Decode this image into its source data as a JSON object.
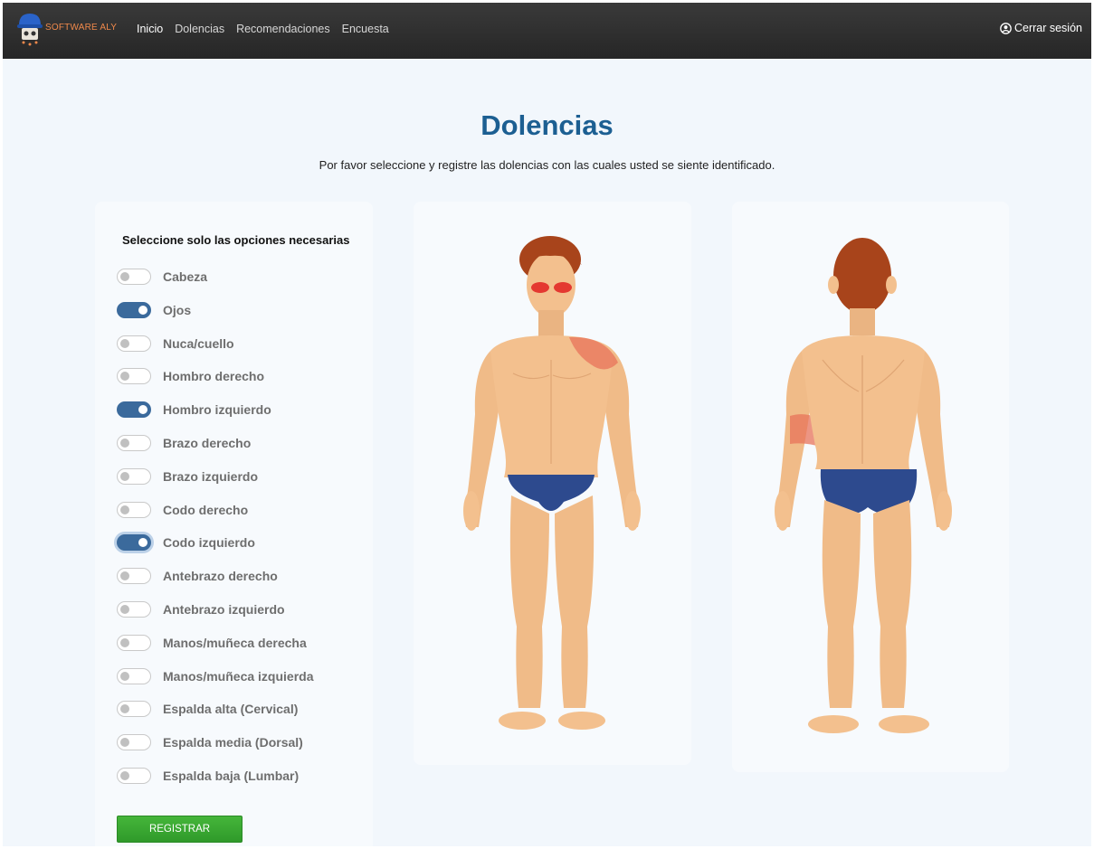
{
  "brand": {
    "name": "SOFTWARE ALY"
  },
  "nav": {
    "links": [
      "Inicio",
      "Dolencias",
      "Recomendaciones",
      "Encuesta"
    ],
    "active": "Inicio",
    "logout_label": "Cerrar sesión"
  },
  "page": {
    "title": "Dolencias",
    "subtitle": "Por favor seleccione y registre las dolencias con las cuales usted se siente identificado."
  },
  "form": {
    "heading": "Seleccione solo las opciones necesarias",
    "options": [
      {
        "label": "Cabeza",
        "checked": false
      },
      {
        "label": "Ojos",
        "checked": true
      },
      {
        "label": "Nuca/cuello",
        "checked": false
      },
      {
        "label": "Hombro derecho",
        "checked": false
      },
      {
        "label": "Hombro izquierdo",
        "checked": true
      },
      {
        "label": "Brazo derecho",
        "checked": false
      },
      {
        "label": "Brazo izquierdo",
        "checked": false
      },
      {
        "label": "Codo derecho",
        "checked": false
      },
      {
        "label": "Codo izquierdo",
        "checked": true
      },
      {
        "label": "Antebrazo derecho",
        "checked": false
      },
      {
        "label": "Antebrazo izquierdo",
        "checked": false
      },
      {
        "label": "Manos/muñeca derecha",
        "checked": false
      },
      {
        "label": "Manos/muñeca izquierda",
        "checked": false
      },
      {
        "label": "Espalda alta (Cervical)",
        "checked": false
      },
      {
        "label": "Espalda media (Dorsal)",
        "checked": false
      },
      {
        "label": "Espalda baja (Lumbar)",
        "checked": false
      }
    ],
    "focused_option": "Codo izquierdo",
    "submit_label": "REGISTRAR"
  },
  "colors": {
    "title": "#1c5f92",
    "toggle_on": "#3b6a9c",
    "register": "#3aa934",
    "highlight": "#e8735a",
    "skin": "#f3c08e",
    "hair": "#a8441b",
    "briefs": "#2d4a8e"
  }
}
